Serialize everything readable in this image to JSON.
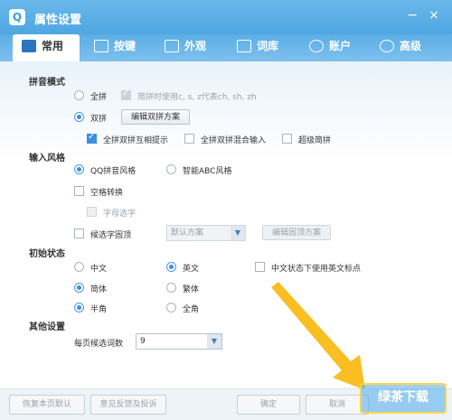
{
  "window": {
    "title": "属性设置",
    "logo": "Q",
    "minimize": "−",
    "close": "×"
  },
  "tabs": [
    {
      "label": "常用",
      "icon": "monitor-icon",
      "active": true
    },
    {
      "label": "按键",
      "icon": "key-q-icon",
      "active": false
    },
    {
      "label": "外观",
      "icon": "shirt-icon",
      "active": false
    },
    {
      "label": "词库",
      "icon": "book-icon",
      "active": false
    },
    {
      "label": "账户",
      "icon": "user-icon",
      "active": false
    },
    {
      "label": "高级",
      "icon": "gear-icon",
      "active": false
    }
  ],
  "pinyin_mode": {
    "label": "拼音模式",
    "quanpin": "全拼",
    "quanpin_hint": "简拼时使用c, s, z代表ch, sh, zh",
    "shuangpin": "双拼",
    "edit_shuangpin": "编辑双拼方案",
    "mutual_hint": "全拼双拼互相提示",
    "mixed_input": "全拼双拼混合输入",
    "super_jianpin": "超级简拼"
  },
  "input_style": {
    "label": "输入风格",
    "qq_style": "QQ拼音风格",
    "abc_style": "智能ABC风格",
    "space_convert": "空格转换",
    "char_select": "字母选字",
    "candidate_top": "候选字固顶",
    "default_scheme": "默认方案",
    "edit_top_scheme": "编辑固顶方案"
  },
  "initial_state": {
    "label": "初始状态",
    "chinese": "中文",
    "english": "英文",
    "english_punct": "中文状态下使用英文标点",
    "simplified": "简体",
    "traditional": "繁体",
    "half_width": "半角",
    "full_width": "全角"
  },
  "other": {
    "label": "其他设置",
    "candidates_per_page": "每页候选词数",
    "candidates_value": "9"
  },
  "footer": {
    "restore": "恢复本页默认",
    "feedback": "意见反馈及投诉",
    "ok": "确定",
    "cancel": "取消",
    "watermark": "绿茶下载"
  }
}
